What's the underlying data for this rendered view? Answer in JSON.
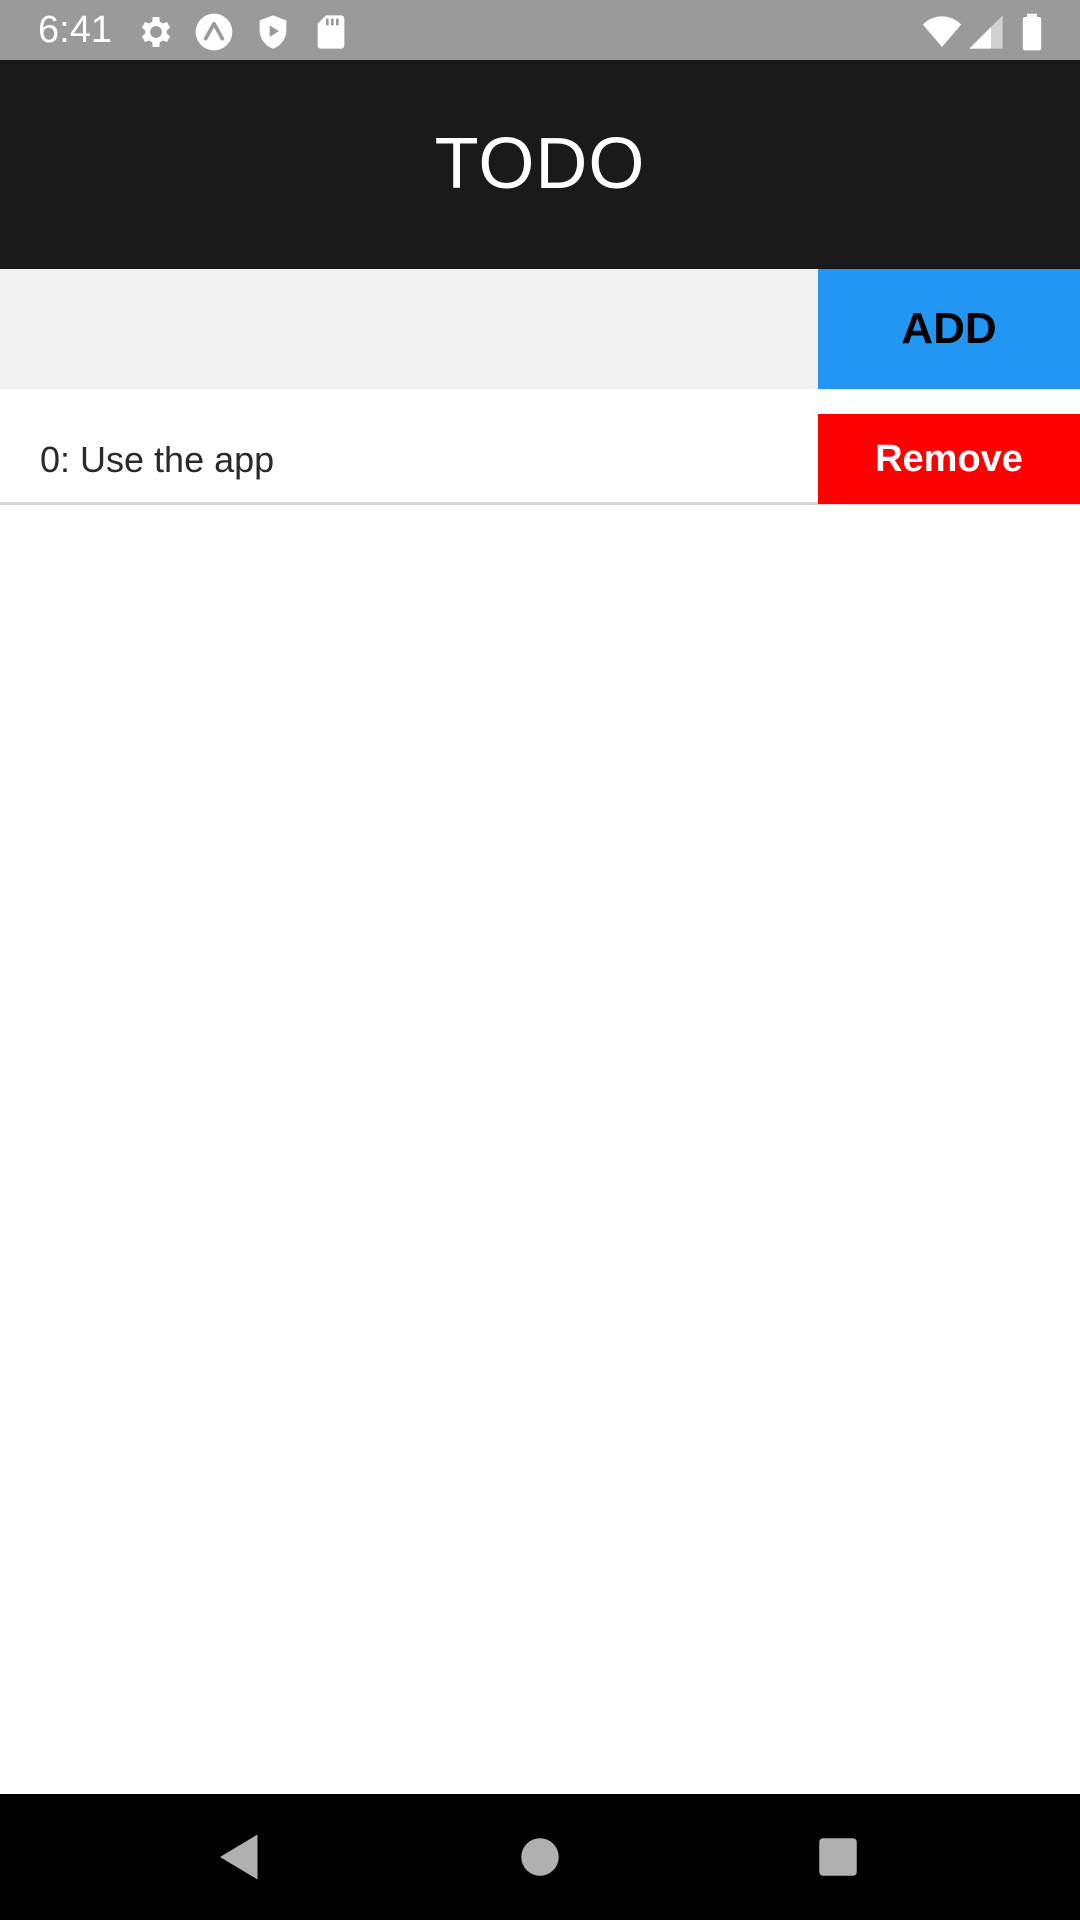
{
  "status_bar": {
    "time": "6:41",
    "icons_left": [
      "gear-icon",
      "expo-icon",
      "shield-play-icon",
      "sd-card-icon"
    ],
    "icons_right": [
      "wifi-icon",
      "cell-signal-icon",
      "battery-icon"
    ]
  },
  "header": {
    "title": "TODO"
  },
  "input": {
    "value": "",
    "placeholder": "",
    "add_label": "ADD"
  },
  "todos": [
    {
      "text": "0: Use the app",
      "remove_label": "Remove"
    }
  ],
  "nav_bar": {
    "buttons": [
      "back-icon",
      "home-icon",
      "recents-icon"
    ]
  },
  "colors": {
    "status_bar": "#9a9a9a",
    "header": "#1a1a1a",
    "add_button": "#2196f3",
    "remove_button": "#ff0000",
    "input_background": "#f2f2f2",
    "nav_bar": "#000000"
  }
}
